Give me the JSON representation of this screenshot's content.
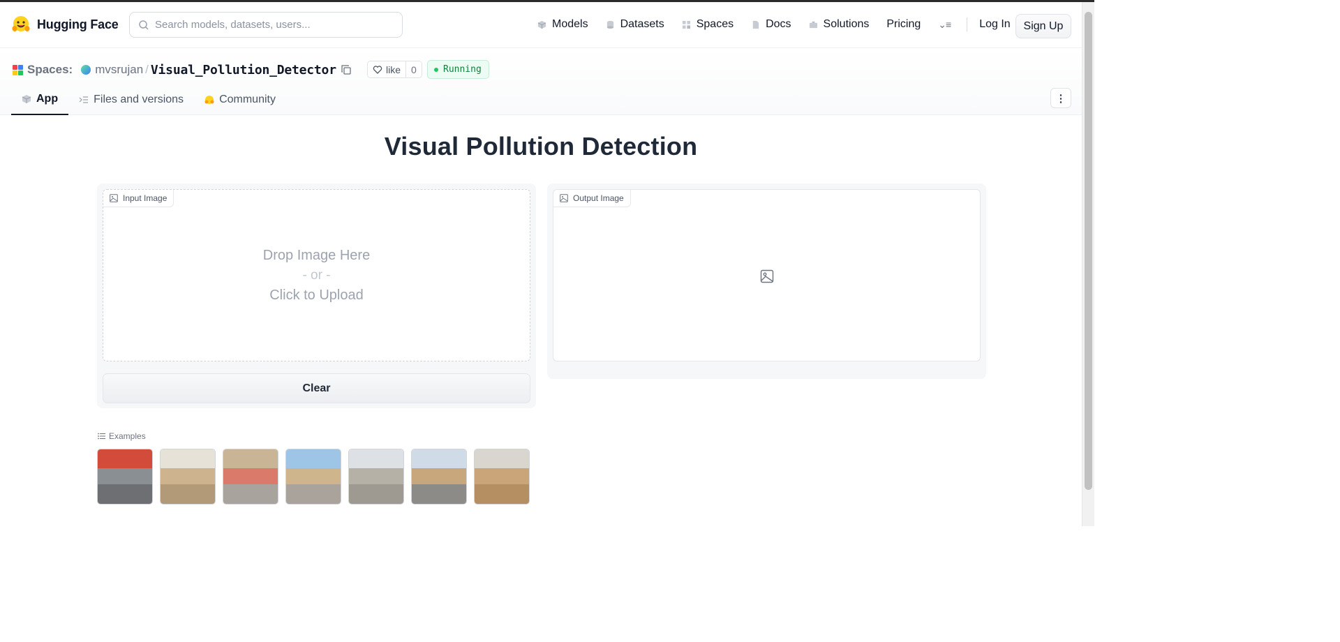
{
  "nav": {
    "brand": "Hugging Face",
    "search_placeholder": "Search models, datasets, users...",
    "links": [
      {
        "label": "Models",
        "icon": "cube-icon"
      },
      {
        "label": "Datasets",
        "icon": "database-icon"
      },
      {
        "label": "Spaces",
        "icon": "grid-icon"
      },
      {
        "label": "Docs",
        "icon": "doc-icon"
      },
      {
        "label": "Solutions",
        "icon": "briefcase-icon"
      },
      {
        "label": "Pricing",
        "icon": ""
      }
    ],
    "login": "Log In",
    "signup": "Sign Up"
  },
  "space": {
    "section_label": "Spaces:",
    "owner": "mvsrujan",
    "separator": "/",
    "repo": "Visual_Pollution_Detector",
    "like_label": "like",
    "like_count": "0",
    "status": "Running",
    "tabs": [
      {
        "label": "App",
        "icon": "cube-icon",
        "active": true
      },
      {
        "label": "Files and versions",
        "icon": "files-icon",
        "active": false
      },
      {
        "label": "Community",
        "icon": "hug-icon",
        "active": false
      }
    ]
  },
  "app": {
    "title": "Visual Pollution Detection",
    "input_label": "Input Image",
    "drop_line1": "Drop Image Here",
    "drop_or": "- or -",
    "drop_line2": "Click to Upload",
    "clear_button": "Clear",
    "output_label": "Output Image",
    "examples_label": "Examples",
    "examples": [
      {
        "name": "example-1",
        "colors": [
          "#d34b3a",
          "#8a8f94",
          "#6d6f72"
        ]
      },
      {
        "name": "example-2",
        "colors": [
          "#e6e2d8",
          "#cdb48e",
          "#b29a78"
        ]
      },
      {
        "name": "example-3",
        "colors": [
          "#c9b596",
          "#d97a6a",
          "#a8a39c"
        ]
      },
      {
        "name": "example-4",
        "colors": [
          "#9ec4e6",
          "#cfb58c",
          "#a9a39b"
        ]
      },
      {
        "name": "example-5",
        "colors": [
          "#dde1e5",
          "#b6b1a7",
          "#9f9a91"
        ]
      },
      {
        "name": "example-6",
        "colors": [
          "#cfdbe6",
          "#c9a77c",
          "#8d8b88"
        ]
      },
      {
        "name": "example-7",
        "colors": [
          "#d9d5cf",
          "#caa57a",
          "#b58e62"
        ]
      }
    ]
  },
  "colors": {
    "accent_running": "#15803d",
    "running_bg": "#ecfbf3",
    "text_primary": "#111827",
    "text_muted": "#6b7280"
  }
}
